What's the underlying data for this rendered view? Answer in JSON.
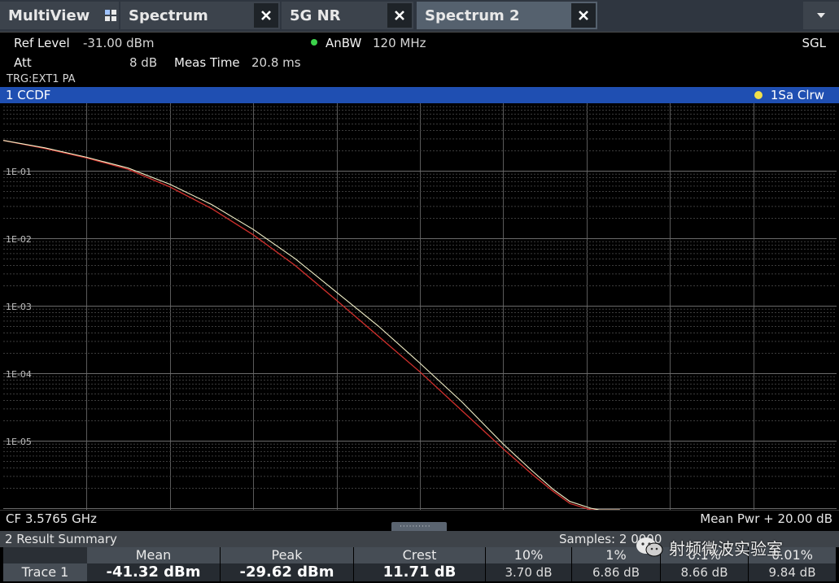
{
  "tabs": [
    {
      "label": "MultiView"
    },
    {
      "label": "Spectrum"
    },
    {
      "label": "5G NR"
    },
    {
      "label": "Spectrum 2"
    }
  ],
  "info": {
    "ref_level_label": "Ref Level",
    "ref_level_value": "-31.00 dBm",
    "att_label": "Att",
    "att_value": "8 dB",
    "meas_time_label": "Meas Time",
    "meas_time_value": "20.8 ms",
    "anbw_label": "AnBW",
    "anbw_value": "120 MHz",
    "sweep_mode": "SGL",
    "trigger": "TRG:EXT1 PA",
    "status_color": "#3bd24a"
  },
  "diagram": {
    "title": "1 CCDF",
    "trace_info": "1Sa Clrw",
    "y_labels": [
      "1E-01",
      "1E-02",
      "1E-03",
      "1E-04",
      "1E-05"
    ],
    "cf": "CF 3.5765 GHz",
    "x_span": "Mean Pwr + 20.00 dB",
    "trace_colors": {
      "trace1": "#f3f0c8",
      "trace2": "#d2302c"
    }
  },
  "chart_data": {
    "type": "line",
    "ylim_exp": [
      -6,
      0.4
    ],
    "xlim": [
      0,
      20
    ],
    "series": [
      {
        "x": [
          0,
          1,
          2,
          3,
          4,
          5,
          6,
          7,
          8,
          9,
          10,
          11,
          12,
          12.7,
          13.2,
          13.6,
          14.1,
          14.3,
          14.6,
          14.8
        ],
        "log_y": [
          -0.55,
          -0.66,
          -0.8,
          -0.96,
          -1.2,
          -1.5,
          -1.87,
          -2.3,
          -2.8,
          -3.3,
          -3.85,
          -4.42,
          -5.05,
          -5.45,
          -5.72,
          -5.9,
          -6.0,
          -6.15,
          -6.3,
          -6.5
        ]
      },
      {
        "x": [
          0,
          1,
          2,
          3,
          4,
          5,
          6,
          7,
          8,
          9,
          10,
          11,
          12,
          12.7,
          13.2,
          13.6,
          14.1,
          14.3,
          14.6,
          14.8
        ],
        "log_y": [
          -0.55,
          -0.67,
          -0.81,
          -0.98,
          -1.24,
          -1.56,
          -1.95,
          -2.4,
          -2.92,
          -3.45,
          -3.98,
          -4.55,
          -5.12,
          -5.5,
          -5.75,
          -5.93,
          -6.05,
          -6.2,
          -6.35,
          -6.5
        ]
      }
    ]
  },
  "summary": {
    "title": "2 Result Summary",
    "samples_label": "Samples:",
    "samples_value": "2 0000",
    "columns": [
      "Mean",
      "Peak",
      "Crest",
      "10%",
      "1%",
      "0.1%",
      "0.01%"
    ],
    "row_label": "Trace 1",
    "values": [
      "-41.32 dBm",
      "-29.62 dBm",
      "11.71 dB",
      "3.70 dB",
      "6.86 dB",
      "8.66 dB",
      "9.84 dB"
    ]
  },
  "watermark": {
    "text": "射频微波实验室"
  }
}
